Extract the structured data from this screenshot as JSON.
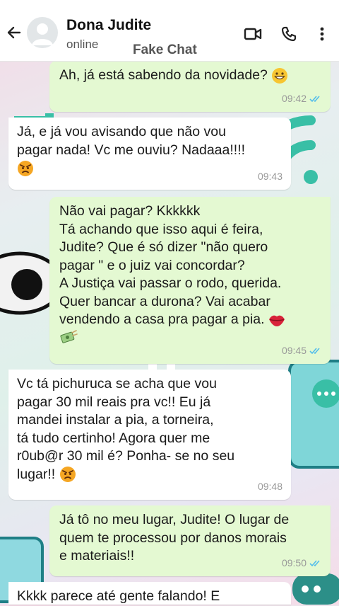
{
  "contact": {
    "name": "Dona Judite",
    "status": "online"
  },
  "watermark": "Fake Chat",
  "messages": [
    {
      "text": "Ah, já está sabendo da novidade?",
      "time": "09:42"
    },
    {
      "text": "Já, e já vou avisando que não vou\npagar nada! Vc me ouviu? Nadaaa!!!!",
      "time": "09:43"
    },
    {
      "text": "Não vai pagar? Kkkkkk\nTá achando que isso aqui é feira,\nJudite? Que é só dizer \"não quero\npagar \" e o juiz vai concordar?\nA Justiça vai passar o rodo, querida.\nQuer bancar a durona? Vai acabar\nvendendo a casa pra pagar a pia.",
      "time": "09:45"
    },
    {
      "text": "Vc tá pichuruca se acha que vou\npagar 30 mil reais pra vc!! Eu já\nmandei instalar a pia, a torneira,\ntá tudo certinho! Agora quer me\nr0ub@r 30 mil é? Ponha- se no seu\nlugar!!",
      "time": "09:48"
    },
    {
      "text": "Já tô no meu lugar, Judite! O lugar de\nquem te processou por danos morais\ne materiais!!",
      "time": "09:50"
    },
    {
      "text": "Kkkk parece até gente falando! E"
    }
  ],
  "colors": {
    "outgoing": "#e4f9d2",
    "incoming": "#ffffff",
    "read_ticks": "#53bdeb"
  },
  "icons": [
    "back-arrow-icon",
    "avatar-placeholder-icon",
    "video-call-icon",
    "phone-icon",
    "more-options-icon",
    "grin-emoji-icon",
    "angry-emoji-icon",
    "lips-emoji-icon",
    "money-emoji-icon",
    "double-check-icon"
  ]
}
